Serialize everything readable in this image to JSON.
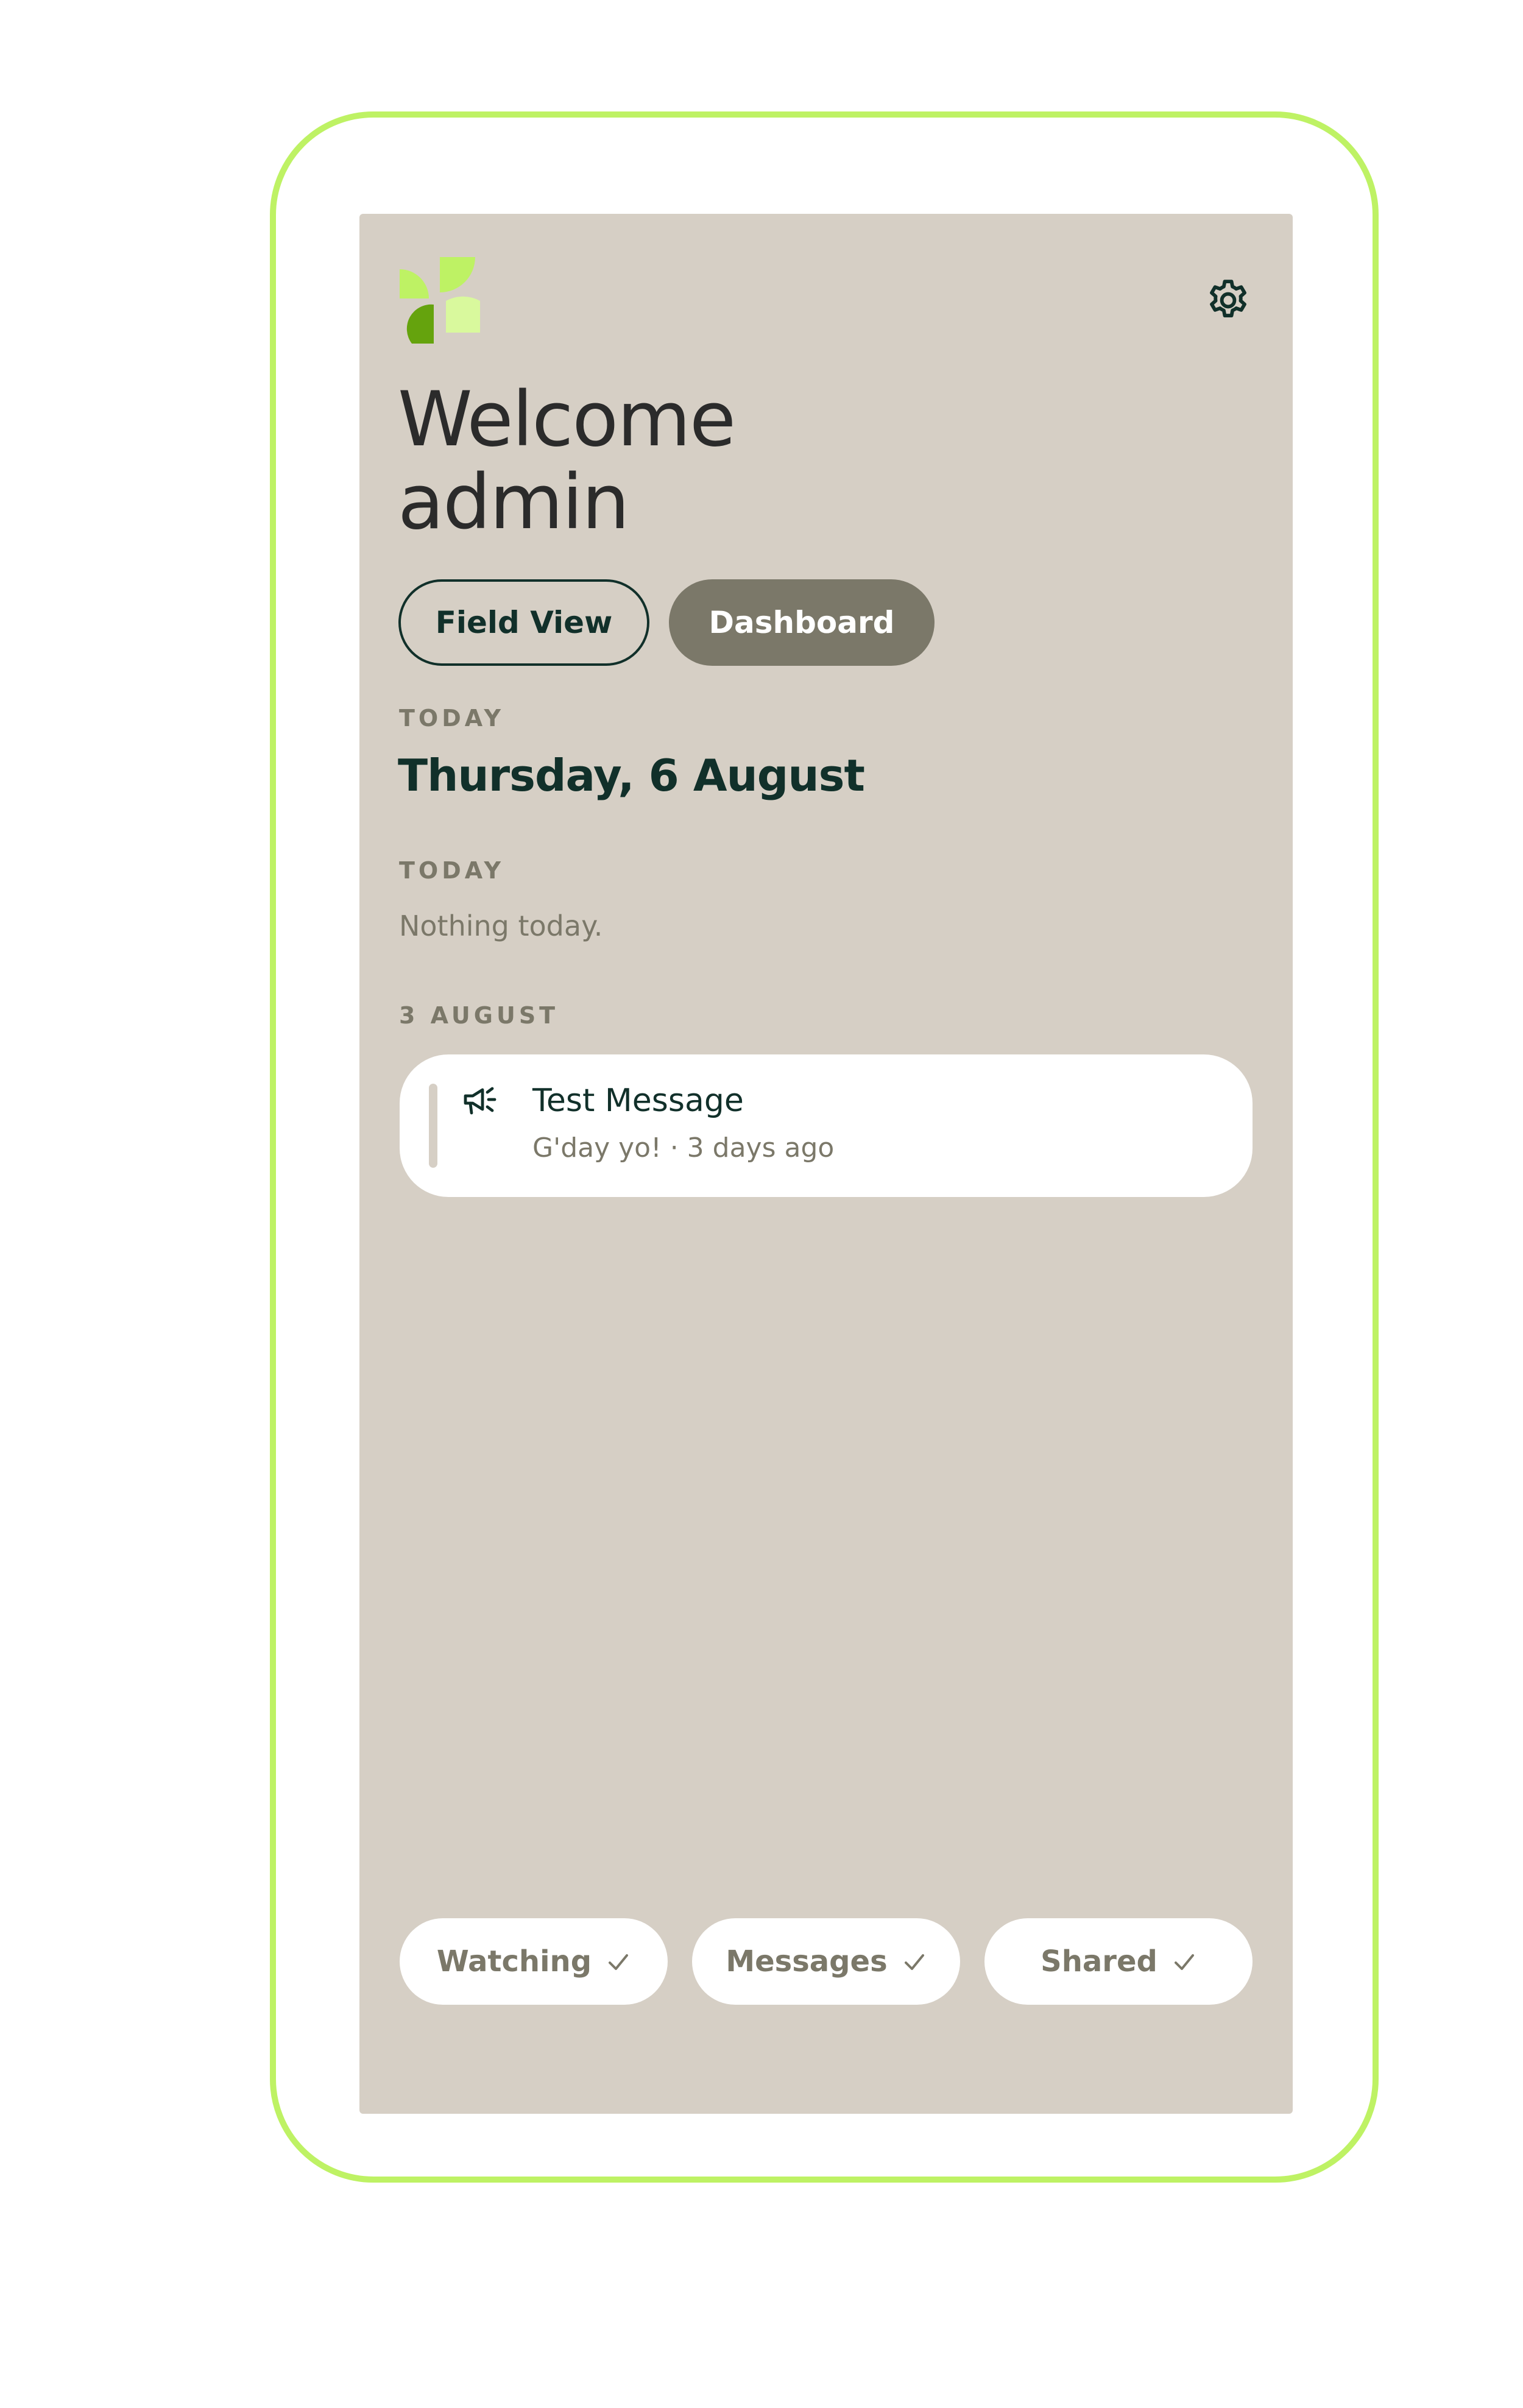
{
  "header": {
    "logo_icon": "pinwheel-logo",
    "settings_icon": "gear-icon"
  },
  "welcome": {
    "line1": "Welcome",
    "line2": "admin"
  },
  "view_toggle": {
    "field_view_label": "Field View",
    "dashboard_label": "Dashboard",
    "active": "Dashboard"
  },
  "today_section": {
    "label": "TODAY",
    "date": "Thursday, 6 August"
  },
  "today_items": {
    "label": "TODAY",
    "empty_text": "Nothing today."
  },
  "older_section": {
    "label": "3 AUGUST",
    "items": [
      {
        "icon": "megaphone-icon",
        "title": "Test Message",
        "subtitle": "G'day yo! · 3 days ago"
      }
    ]
  },
  "filters": [
    {
      "label": "Watching",
      "checked": true
    },
    {
      "label": "Messages",
      "checked": true
    },
    {
      "label": "Shared",
      "checked": true
    }
  ],
  "colors": {
    "frame": "#bef264",
    "screen_bg": "#d6cfc5",
    "text_dark": "#11302a",
    "muted": "#7b7869",
    "logo_light": "#bef264",
    "logo_pale": "#d9f99d",
    "logo_dark": "#65a30d"
  }
}
